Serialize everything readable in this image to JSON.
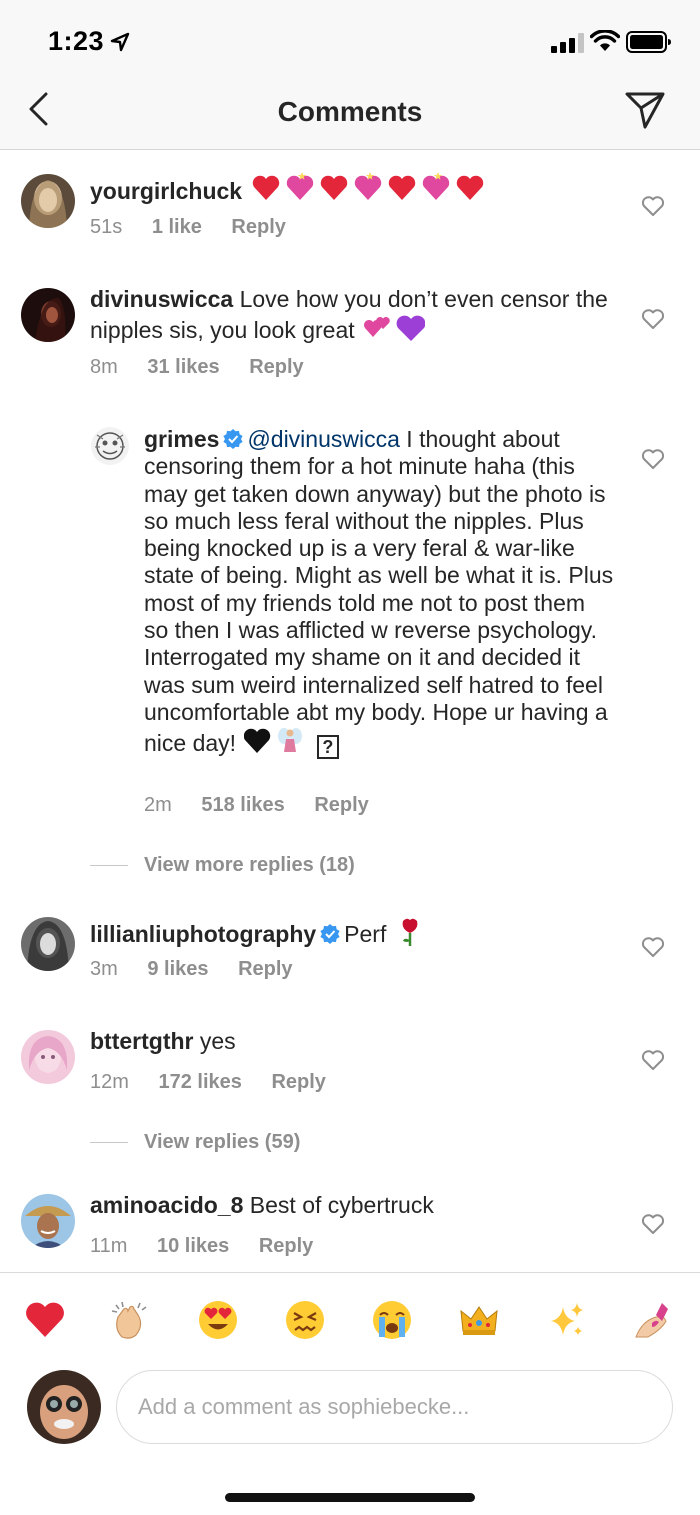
{
  "status_bar": {
    "time": "1:23"
  },
  "header": {
    "title": "Comments"
  },
  "comments": [
    {
      "username": "yourgirlchuck",
      "text": "",
      "time": "51s",
      "likes": "1 like",
      "reply": "Reply"
    },
    {
      "username": "divinuswicca",
      "text": "Love how you don’t even censor the nipples sis, you look great",
      "time": "8m",
      "likes": "31 likes",
      "reply": "Reply"
    },
    {
      "username": "grimes",
      "mention": "@divinuswicca",
      "text": "I thought about censoring them for a hot minute haha (this may get taken down anyway) but the photo is so much less feral without the nipples.  Plus being knocked up is a very feral & war-like state of being.  Might as well be what it is.  Plus most of my friends told me not to post them so then I was afflicted w reverse psychology.  Interrogated my shame on it and decided it was sum weird internalized self hatred to feel uncomfortable abt my body.  Hope ur having a nice day!",
      "time": "2m",
      "likes": "518 likes",
      "reply": "Reply",
      "unknown_glyph": "?"
    },
    {
      "username": "lillianliuphotography",
      "text": "Perf",
      "time": "3m",
      "likes": "9 likes",
      "reply": "Reply"
    },
    {
      "username": "bttertgthr",
      "text": "yes",
      "time": "12m",
      "likes": "172 likes",
      "reply": "Reply"
    },
    {
      "username": "aminoacido_8",
      "text": "Best of cybertruck",
      "time": "11m",
      "likes": "10 likes",
      "reply": "Reply"
    }
  ],
  "view_more_replies": "View more replies (18)",
  "view_replies": "View replies (59)",
  "emoji_tray": [
    "heart",
    "clap",
    "heart-eyes",
    "confounded",
    "crying",
    "crown",
    "sparkles",
    "nail-polish"
  ],
  "input": {
    "placeholder": "Add a comment as sophiebecke..."
  },
  "colors": {
    "accent_verified": "#3897f0",
    "heart_red": "#e3263a",
    "muted_text": "#8e8e8e"
  }
}
